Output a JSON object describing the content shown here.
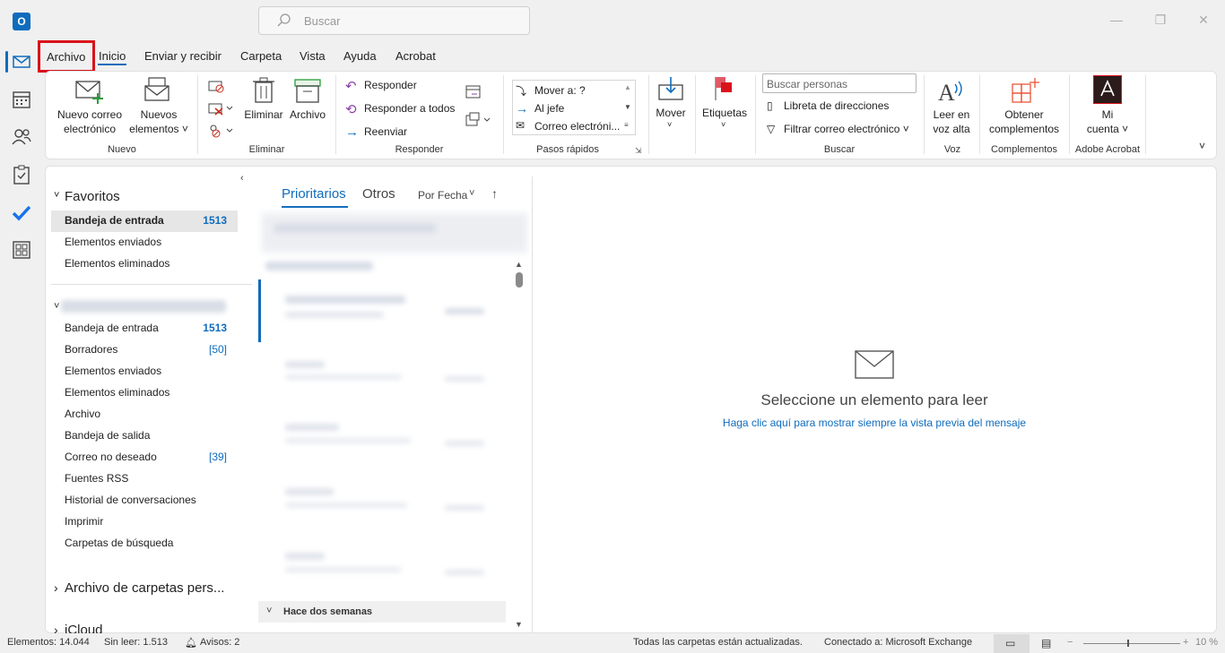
{
  "search": {
    "placeholder": "Buscar"
  },
  "menu": {
    "archivo": "Archivo",
    "inicio": "Inicio",
    "enviar": "Enviar y recibir",
    "carpeta": "Carpeta",
    "vista": "Vista",
    "ayuda": "Ayuda",
    "acrobat": "Acrobat"
  },
  "ribbon": {
    "nuevo_correo_1": "Nuevo correo",
    "nuevo_correo_2": "electrónico",
    "nuevos_1": "Nuevos",
    "nuevos_2": "elementos ˅",
    "grp_nuevo": "Nuevo",
    "eliminar": "Eliminar",
    "archivo": "Archivo",
    "grp_eliminar": "Eliminar",
    "responder": "Responder",
    "responder_todos": "Responder a todos",
    "reenviar": "Reenviar",
    "grp_responder": "Responder",
    "qs_mover": "Mover a: ?",
    "qs_jefe": "Al jefe",
    "qs_correo": "Correo electróni...",
    "grp_pasos": "Pasos rápidos",
    "mover": "Mover",
    "etiquetas": "Etiquetas",
    "buscar_personas": "Buscar personas",
    "libreta": "Libreta de direcciones",
    "filtrar": "Filtrar correo electrónico ˅",
    "grp_buscar": "Buscar",
    "leer_1": "Leer en",
    "leer_2": "voz alta",
    "grp_voz": "Voz",
    "obtener_1": "Obtener",
    "obtener_2": "complementos",
    "grp_complementos": "Complementos",
    "micuenta_1": "Mi",
    "micuenta_2": "cuenta ˅",
    "grp_acrobat": "Adobe Acrobat"
  },
  "folders": {
    "favoritos": "Favoritos",
    "fav_items": [
      {
        "label": "Bandeja de entrada",
        "count": "1513"
      },
      {
        "label": "Elementos enviados",
        "count": ""
      },
      {
        "label": "Elementos eliminados",
        "count": ""
      }
    ],
    "account_items": [
      {
        "label": "Bandeja de entrada",
        "count": "1513"
      },
      {
        "label": "Borradores",
        "count": "[50]"
      },
      {
        "label": "Elementos enviados",
        "count": ""
      },
      {
        "label": "Elementos eliminados",
        "count": ""
      },
      {
        "label": "Archivo",
        "count": ""
      },
      {
        "label": "Bandeja de salida",
        "count": ""
      },
      {
        "label": "Correo no deseado",
        "count": "[39]"
      },
      {
        "label": "Fuentes RSS",
        "count": ""
      },
      {
        "label": "Historial de conversaciones",
        "count": ""
      },
      {
        "label": "Imprimir",
        "count": ""
      },
      {
        "label": "Carpetas de búsqueda",
        "count": ""
      }
    ],
    "archivo_carpetas": "Archivo de carpetas pers...",
    "icloud": "iCloud"
  },
  "list": {
    "tab_prioritarios": "Prioritarios",
    "tab_otros": "Otros",
    "sort": "Por Fecha",
    "group_header": "Hace dos semanas"
  },
  "reading": {
    "title": "Seleccione un elemento para leer",
    "link": "Haga clic aquí para mostrar siempre la vista previa del mensaje"
  },
  "status": {
    "elementos": "Elementos: 14.044",
    "sin_leer": "Sin leer: 1.513",
    "avisos": "Avisos: 2",
    "actualizadas": "Todas las carpetas están actualizadas.",
    "conectado": "Conectado a: Microsoft Exchange",
    "zoom": "10 %"
  },
  "colors": {
    "accent": "#0f6cbd",
    "highlight_box": "#d9121b"
  }
}
